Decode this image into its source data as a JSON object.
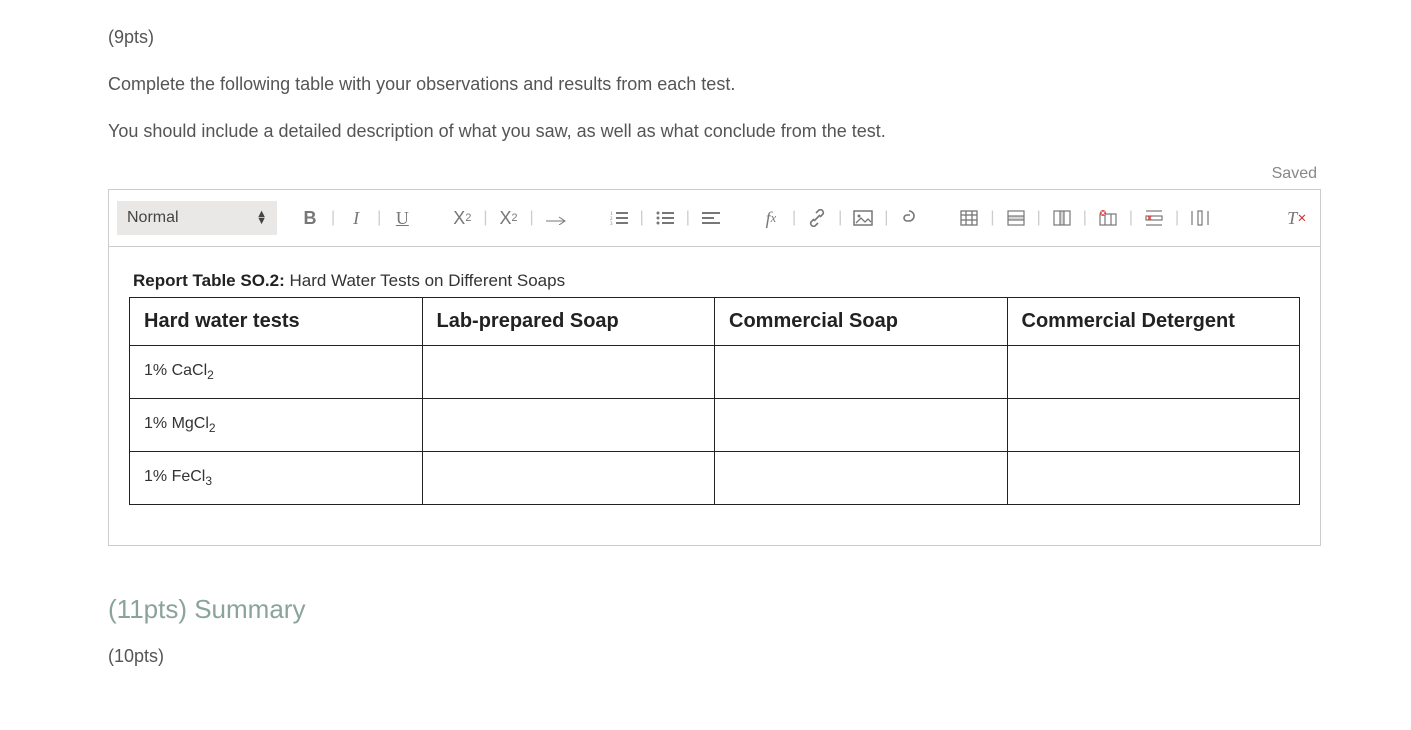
{
  "question": {
    "points_label": "(9pts)",
    "line1": "Complete the following table with your observations and results from each test.",
    "line2": "You should include a detailed description of what you saw, as well as what conclude from the test."
  },
  "editor": {
    "saved_label": "Saved",
    "format_style": "Normal",
    "caption_bold": "Report Table SO.2:",
    "caption_rest": " Hard Water Tests on Different Soaps",
    "headers": {
      "col1": "Hard water tests",
      "col2": "Lab-prepared Soap",
      "col3": "Commercial Soap",
      "col4": "Commercial Detergent"
    },
    "rows": [
      {
        "label_pre": "1% CaCl",
        "label_sub": "2",
        "c2": "",
        "c3": "",
        "c4": ""
      },
      {
        "label_pre": "1% MgCl",
        "label_sub": "2",
        "c2": "",
        "c3": "",
        "c4": ""
      },
      {
        "label_pre": "1% FeCl",
        "label_sub": "3",
        "c2": "",
        "c3": "",
        "c4": ""
      }
    ]
  },
  "summary": {
    "heading": "(11pts) Summary",
    "sub_points": "(10pts)"
  }
}
